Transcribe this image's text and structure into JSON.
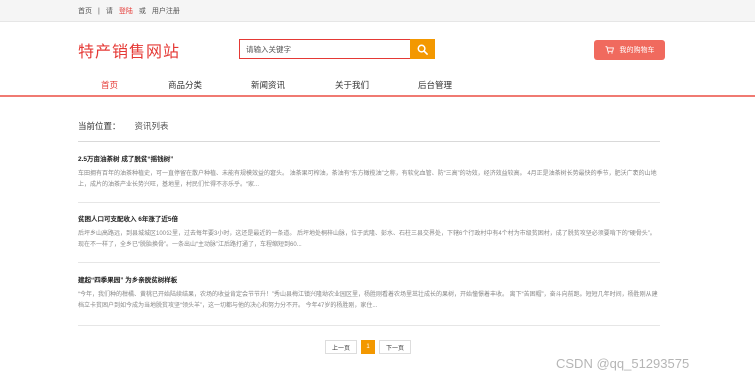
{
  "topbar": {
    "home": "首页",
    "sep": "|",
    "please": "请",
    "login": "登陆",
    "or": "或",
    "register": "用户注册"
  },
  "logo": "特产销售网站",
  "search": {
    "placeholder": "请输入关键字"
  },
  "cart": {
    "label": "我的购物车"
  },
  "nav": {
    "items": [
      "首页",
      "商品分类",
      "新闻资讯",
      "关于我们",
      "后台管理"
    ]
  },
  "breadcrumb": {
    "label": "当前位置：",
    "current": "资讯列表"
  },
  "articles": [
    {
      "title": "2.5万亩油茶树 成了脱贫“摇钱树”",
      "body": "车田拥有百年的油茶种植史，可一直停留在散户种植、未能有规模效益的窘头。 油茶果可榨油，茶油有“东方橄榄油”之称，有软化血管、防“三高”的功效，经济效益较高。 4月正是油茶树长势最快的季节，肥沃广袤的山地上，成片的油茶产业长势兴旺，基地里，村民们忙得不亦乐乎。“家..."
    },
    {
      "title": "贫困人口可支配收入 6年涨了近5倍",
      "body": "后坪乡山高路远，到县城城区100公里，过去每年要3小时，这还是最近的一条道。 后坪地处桐梓山脉，位于武隆、彭水、石柱三县交界处，下辖6个行政村中有4个村为市级贫困村，成了脱贫攻坚必须要啃下的“硬骨头”。 现在不一样了，全乡已“脱胎换骨”。一条出山“主动脉”江后路打通了，车程缩短到60..."
    },
    {
      "title": "建起“四季果园” 为乡亲脱贫树样板",
      "body": "“今年，我们种的柑橘、黄桃已开始陆续结果，农场的收益肯定会节节升！”秀山县梅江镇兴隆坳农业园区里，杨胜刚看着农场里茁壮成长的果树，开始憧憬着丰收。 离下“苦困帽”，奋斗向前跑。短短几年时间，杨胜刚从建档立卡贫困户到如今成为当地脱贫攻坚“领头羊”，这一切都与他的决心和努力分不开。 今年47岁的杨胜刚，家住..."
    }
  ],
  "pager": {
    "prev": "上一页",
    "current": "1",
    "next": "下一页"
  },
  "watermark": "CSDN @qq_51293575",
  "colors": {
    "brand_red": "#e53935",
    "orange": "#f39800",
    "cart_bg": "#f06a5e"
  }
}
